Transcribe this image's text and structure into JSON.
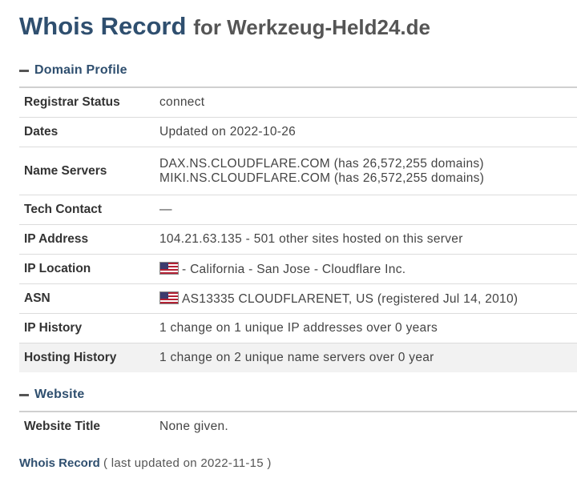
{
  "header": {
    "title": "Whois Record",
    "subtitle": "for Werkzeug-Held24.de"
  },
  "domain_profile": {
    "section_label": "Domain Profile",
    "rows": {
      "registrar_status": {
        "label": "Registrar Status",
        "value": "connect"
      },
      "dates": {
        "label": "Dates",
        "value": "Updated on 2022-10-26"
      },
      "name_servers": {
        "label": "Name Servers",
        "line1": "DAX.NS.CLOUDFLARE.COM (has 26,572,255 domains)",
        "line2": "MIKI.NS.CLOUDFLARE.COM (has 26,572,255 domains)"
      },
      "tech_contact": {
        "label": "Tech Contact",
        "value": "—"
      },
      "ip_address": {
        "label": "IP Address",
        "value": "104.21.63.135 - 501 other sites hosted on this server"
      },
      "ip_location": {
        "label": "IP Location",
        "value": "- California - San Jose - Cloudflare Inc.",
        "flag_icon": "us-flag-icon"
      },
      "asn": {
        "label": "ASN",
        "value": "AS13335 CLOUDFLARENET, US (registered Jul 14, 2010)",
        "flag_icon": "us-flag-icon"
      },
      "ip_history": {
        "label": "IP History",
        "value": "1 change on 1 unique IP addresses over 0 years"
      },
      "hosting_history": {
        "label": "Hosting History",
        "value": "1 change on 2 unique name servers over 0 year"
      }
    }
  },
  "website": {
    "section_label": "Website",
    "rows": {
      "website_title": {
        "label": "Website Title",
        "value": "None given."
      }
    }
  },
  "footer": {
    "label": "Whois Record",
    "note": "( last updated on 2022-11-15 )"
  },
  "colors": {
    "heading_blue": "#2f4f6f",
    "text": "#333333",
    "row_shade": "#f2f2f2"
  }
}
